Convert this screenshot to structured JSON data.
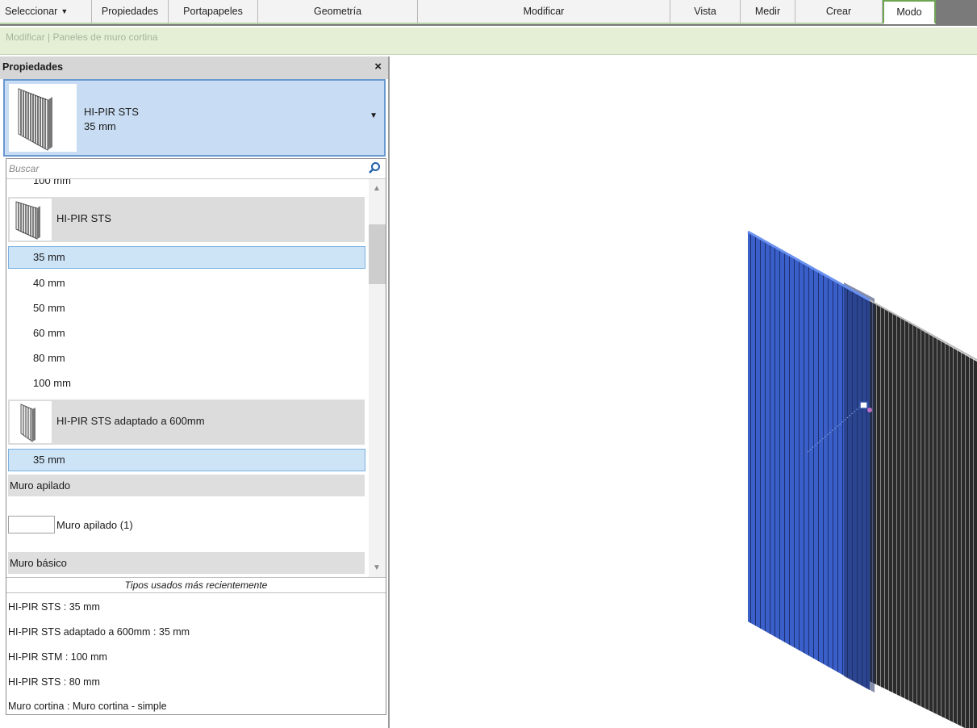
{
  "ribbon": {
    "panels": [
      {
        "label": "Seleccionar",
        "has_dropdown": true
      },
      {
        "label": "Propiedades"
      },
      {
        "label": "Portapapeles"
      },
      {
        "label": "Geometría"
      },
      {
        "label": "Modificar"
      },
      {
        "label": "Vista"
      },
      {
        "label": "Medir"
      },
      {
        "label": "Crear"
      },
      {
        "label": "Modo",
        "active": true
      }
    ]
  },
  "context_tab": "Modificar | Paneles de muro cortina",
  "properties": {
    "title": "Propiedades",
    "close": "×",
    "selected_type": {
      "family": "HI-PIR STS",
      "size": "35 mm"
    },
    "search_placeholder": "Buscar",
    "list": {
      "top_item": "100 mm",
      "family1": "HI-PIR STS",
      "family1_sizes": [
        "35 mm",
        "40 mm",
        "50 mm",
        "60 mm",
        "80 mm",
        "100 mm"
      ],
      "family2": "HI-PIR STS adaptado a 600mm",
      "family2_sizes": [
        "35 mm"
      ],
      "group_stacked": "Muro apilado",
      "stacked_item": "Muro apilado (1)",
      "group_basic": "Muro básico"
    },
    "recent_header": "Tipos usados más recientemente",
    "recent_items": [
      "HI-PIR STS : 35 mm",
      "HI-PIR STS adaptado a 600mm : 35 mm",
      "HI-PIR STM : 100 mm",
      "HI-PIR STS : 80 mm",
      "Muro cortina : Muro cortina - simple"
    ]
  },
  "colors": {
    "ribbon_active": "#6fa455",
    "context_bar": "#e4efd6",
    "selection": "#cde4f7",
    "panel_selected": "#3a5fc8",
    "panel_dark": "#2c2c2c"
  }
}
